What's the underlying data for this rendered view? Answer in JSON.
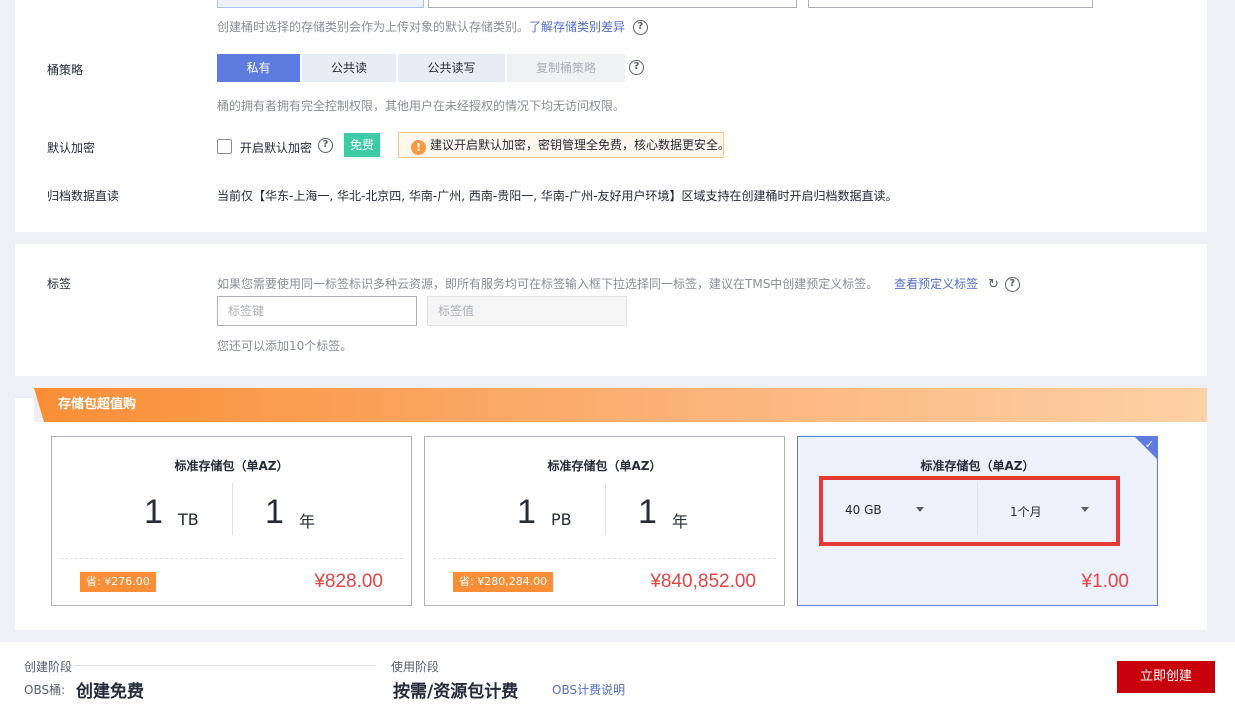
{
  "storage_class": {
    "hint": "创建桶时选择的存储类别会作为上传对象的默认存储类别。",
    "link": "了解存储类别差异"
  },
  "bucket_policy": {
    "label": "桶策略",
    "options": [
      "私有",
      "公共读",
      "公共读写",
      "复制桶策略"
    ],
    "selected": "私有",
    "hint": "桶的拥有者拥有完全控制权限，其他用户在未经授权的情况下均无访问权限。"
  },
  "encryption": {
    "label": "默认加密",
    "checkbox_label": "开启默认加密",
    "badge": "免费",
    "warning": "建议开启默认加密，密钥管理全免费，核心数据更安全。"
  },
  "archive": {
    "label": "归档数据直读",
    "text": "当前仅【华东-上海一, 华北-北京四, 华南-广州, 西南-贵阳一, 华南-广州-友好用户环境】区域支持在创建桶时开启归档数据直读。"
  },
  "tags": {
    "label": "标签",
    "hint": "如果您需要使用同一标签标识多种云资源，即所有服务均可在标签输入框下拉选择同一标签，建议在TMS中创建预定义标签。",
    "link": "查看预定义标签",
    "key_placeholder": "标签键",
    "value_placeholder": "标签值",
    "remaining": "您还可以添加10个标签。"
  },
  "packages": {
    "banner": "存储包超值购",
    "cards": [
      {
        "title": "标准存储包（单AZ）",
        "capacity": "1",
        "capacity_unit": "TB",
        "duration": "1",
        "duration_unit": "年",
        "save": "省: ¥276.00",
        "price": "¥828.00"
      },
      {
        "title": "标准存储包（单AZ）",
        "capacity": "1",
        "capacity_unit": "PB",
        "duration": "1",
        "duration_unit": "年",
        "save": "省: ¥280,284.00",
        "price": "¥840,852.00"
      },
      {
        "title": "标准存储包（单AZ）",
        "capacity_select": "40 GB",
        "duration_select": "1个月",
        "price": "¥1.00",
        "selected": true
      }
    ]
  },
  "footer": {
    "create_stage_label": "创建阶段",
    "obs_label": "OBS桶:",
    "obs_value": "创建免费",
    "use_stage_label": "使用阶段",
    "use_value": "按需/资源包计费",
    "billing_link": "OBS计费说明",
    "create_button": "立即创建"
  },
  "colors": {
    "accent": "#5e7ce0",
    "primary_button": "#c7000b",
    "price": "#e54545",
    "banner": "#f98e36"
  }
}
